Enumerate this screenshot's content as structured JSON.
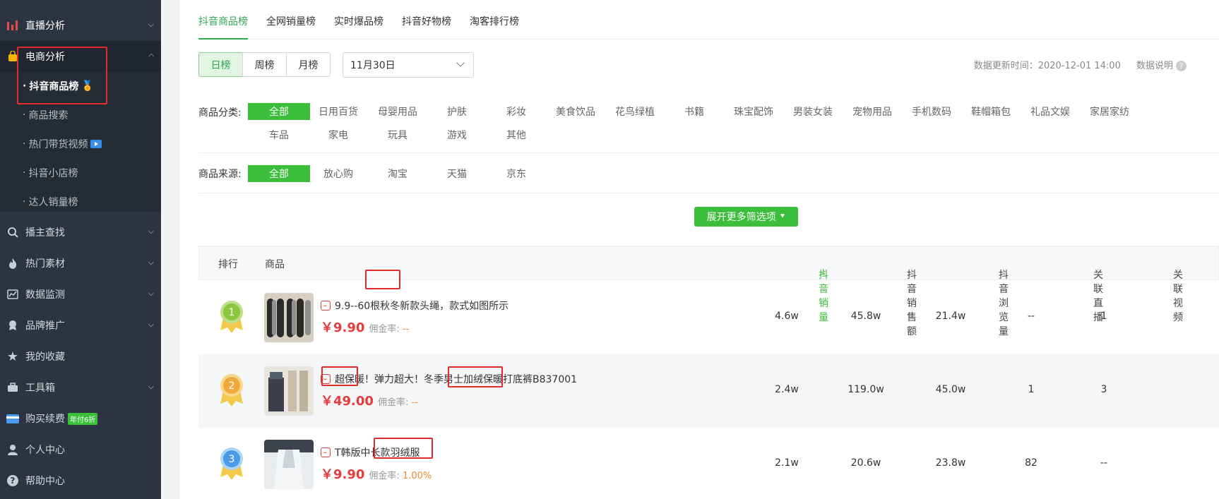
{
  "sidebar": {
    "items": [
      {
        "label": "直播分析",
        "icon": "bar-chart-icon"
      },
      {
        "label": "电商分析",
        "icon": "shopping-bag-icon"
      },
      {
        "label": "播主查找",
        "icon": "search-icon"
      },
      {
        "label": "热门素材",
        "icon": "flame-icon"
      },
      {
        "label": "数据监测",
        "icon": "monitor-chart-icon"
      },
      {
        "label": "品牌推广",
        "icon": "badge-icon"
      },
      {
        "label": "我的收藏",
        "icon": "star-icon"
      },
      {
        "label": "工具箱",
        "icon": "toolbox-icon"
      },
      {
        "label": "购买续费",
        "icon": "card-icon",
        "badge": "年付6折"
      },
      {
        "label": "个人中心",
        "icon": "user-icon"
      },
      {
        "label": "帮助中心",
        "icon": "help-icon"
      }
    ],
    "sub_items": [
      {
        "label": "抖音商品榜"
      },
      {
        "label": "商品搜索"
      },
      {
        "label": "热门带货视频"
      },
      {
        "label": "抖音小店榜"
      },
      {
        "label": "达人销量榜"
      }
    ]
  },
  "tabs": [
    "抖音商品榜",
    "全网销量榜",
    "实时爆品榜",
    "抖音好物榜",
    "淘客排行榜"
  ],
  "period": [
    "日榜",
    "周榜",
    "月榜"
  ],
  "date_select": "11月30日",
  "update_text": "数据更新时间：2020-12-01 14:00",
  "data_note": "数据说明",
  "filters": {
    "category_label": "商品分类:",
    "categories_row1": [
      "全部",
      "日用百货",
      "母婴用品",
      "护肤",
      "彩妆",
      "美食饮品",
      "花鸟绿植",
      "书籍",
      "珠宝配饰",
      "男装女装",
      "宠物用品",
      "手机数码",
      "鞋帽箱包",
      "礼品文娱",
      "家居家纺"
    ],
    "categories_row2": [
      "车品",
      "家电",
      "玩具",
      "游戏",
      "其他"
    ],
    "source_label": "商品来源:",
    "sources": [
      "全部",
      "放心购",
      "淘宝",
      "天猫",
      "京东"
    ],
    "expand_label": "展开更多筛选项"
  },
  "table": {
    "headers": [
      "排行",
      "商品",
      "抖音销量",
      "抖音销售额",
      "抖音浏览量",
      "关联直播",
      "关联视频"
    ],
    "rows": [
      {
        "rank": "1",
        "title": "9.9--60根秋冬新款头绳，款式如图所示",
        "price": "￥9.90",
        "comm_label": "佣金率:",
        "comm": "--",
        "sales": "4.6w",
        "revenue": "45.8w",
        "views": "21.4w",
        "live": "--",
        "video": "1"
      },
      {
        "rank": "2",
        "title": "超保暖！弹力超大！冬季男士加绒保暖打底裤B837001",
        "price": "￥49.00",
        "comm_label": "佣金率:",
        "comm": "--",
        "sales": "2.4w",
        "revenue": "119.0w",
        "views": "45.0w",
        "live": "1",
        "video": "3"
      },
      {
        "rank": "3",
        "title": "T韩版中长款羽绒服",
        "price": "￥9.90",
        "comm_label": "佣金率:",
        "comm": "1.00%",
        "sales": "2.1w",
        "revenue": "20.6w",
        "views": "23.8w",
        "live": "82",
        "video": "--"
      }
    ]
  },
  "colors": {
    "accent": "#3bbf3b",
    "sidebar_bg": "#2b3440",
    "price": "#e53b3b",
    "highlight_box": "#e32b2b"
  }
}
